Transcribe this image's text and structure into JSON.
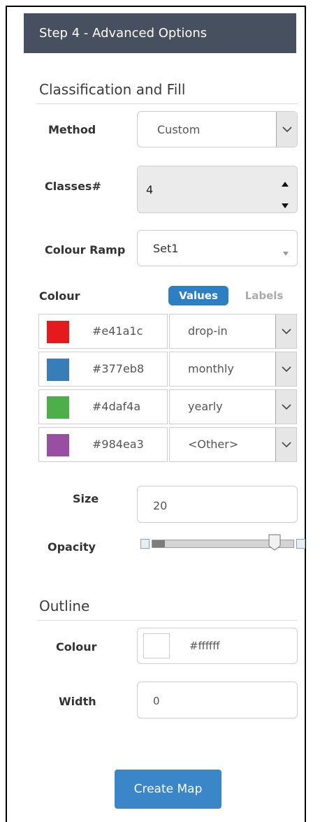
{
  "header": {
    "title": "Step 4 - Advanced Options"
  },
  "classification": {
    "section_title": "Classification and Fill",
    "method_label": "Method",
    "method_value": "Custom",
    "classes_label": "Classes#",
    "classes_value": "4",
    "ramp_label": "Colour Ramp",
    "ramp_value": "Set1",
    "colour_label": "Colour",
    "toggle_values": "Values",
    "toggle_labels": "Labels",
    "rows": [
      {
        "color": "#e41a1c",
        "hex": "#e41a1c",
        "value": "drop-in"
      },
      {
        "color": "#377eb8",
        "hex": "#377eb8",
        "value": "monthly"
      },
      {
        "color": "#4daf4a",
        "hex": "#4daf4a",
        "value": "yearly"
      },
      {
        "color": "#984ea3",
        "hex": "#984ea3",
        "value": "<Other>"
      }
    ],
    "size_label": "Size",
    "size_value": "20",
    "opacity_label": "Opacity",
    "opacity_level": 0.9
  },
  "outline": {
    "section_title": "Outline",
    "colour_label": "Colour",
    "colour_value": "#ffffff",
    "colour_hex": "#ffffff",
    "width_label": "Width",
    "width_value": "0"
  },
  "actions": {
    "create_label": "Create Map"
  }
}
